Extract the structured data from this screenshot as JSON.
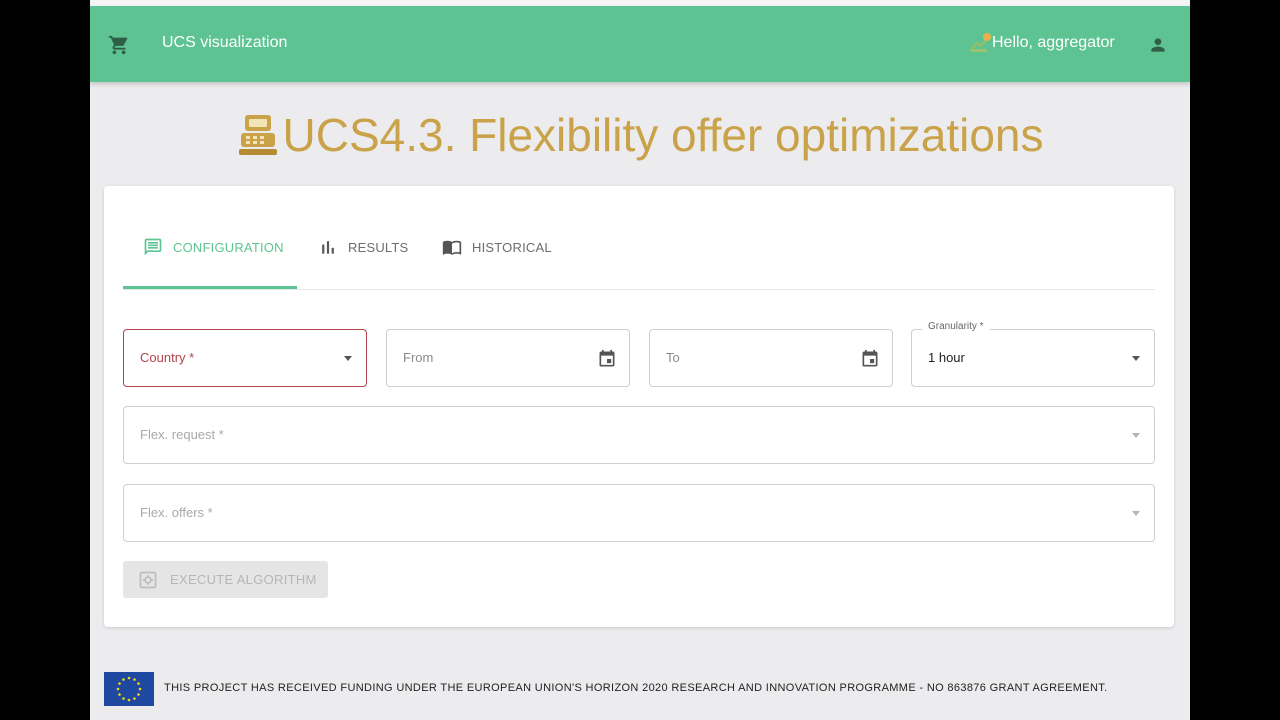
{
  "header": {
    "app_title": "UCS visualization",
    "greeting": "Hello, aggregator",
    "colors": {
      "bar": "#5ec393",
      "title": "#c9a24a",
      "error": "#b2444e"
    },
    "icons": [
      "cart-icon",
      "notification-icon",
      "user-icon"
    ]
  },
  "page": {
    "title": "UCS4.3. Flexibility offer optimizations"
  },
  "tabs": [
    {
      "label": "CONFIGURATION",
      "icon": "configuration-icon",
      "active": true
    },
    {
      "label": "RESULTS",
      "icon": "bar-chart-icon",
      "active": false
    },
    {
      "label": "HISTORICAL",
      "icon": "book-icon",
      "active": false
    }
  ],
  "form": {
    "country": {
      "placeholder": "Country *",
      "value": ""
    },
    "from": {
      "placeholder": "From",
      "value": ""
    },
    "to": {
      "placeholder": "To",
      "value": ""
    },
    "granularity": {
      "label": "Granularity *",
      "value": "1 hour"
    },
    "flex_request": {
      "placeholder": "Flex. request *",
      "value": ""
    },
    "flex_offers": {
      "placeholder": "Flex. offers *",
      "value": ""
    }
  },
  "actions": {
    "execute_label": "EXECUTE ALGORITHM",
    "execute_enabled": false
  },
  "footer": {
    "text": "THIS PROJECT HAS RECEIVED FUNDING UNDER THE EUROPEAN UNION'S HORIZON 2020 RESEARCH AND INNOVATION PROGRAMME - NO 863876 GRANT AGREEMENT."
  }
}
